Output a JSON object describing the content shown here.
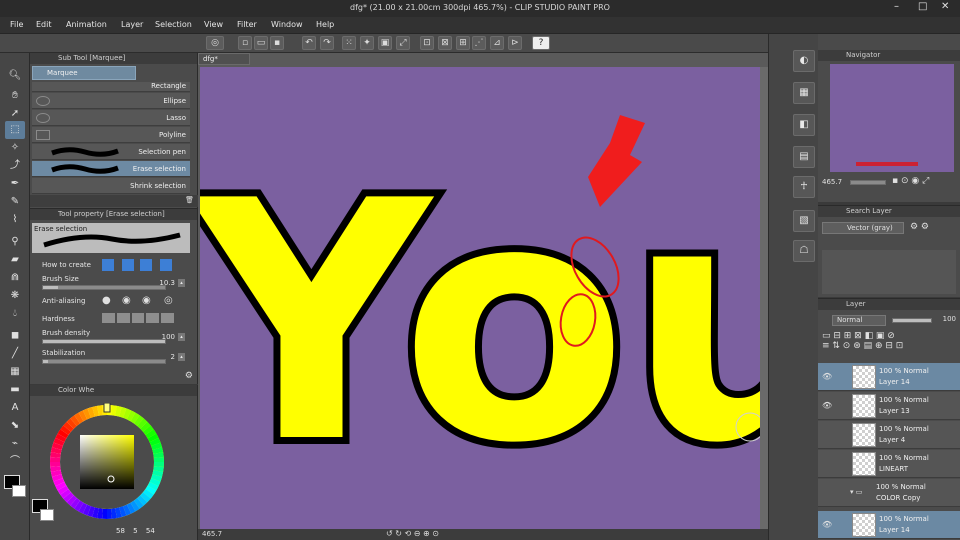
{
  "app": {
    "title": "dfg* (21.00 x 21.00cm 300dpi 465.7%) - CLIP STUDIO PAINT PRO",
    "window_controls": [
      "–",
      "□",
      "✕"
    ]
  },
  "menu": [
    "File",
    "Edit",
    "Animation",
    "Layer",
    "Selection",
    "View",
    "Filter",
    "Window",
    "Help"
  ],
  "subtool": {
    "title": "Sub Tool [Marquee]",
    "tab": "Marquee",
    "items": [
      {
        "label": "Rectangle"
      },
      {
        "label": "Ellipse"
      },
      {
        "label": "Lasso"
      },
      {
        "label": "Polyline"
      },
      {
        "label": "Selection pen"
      },
      {
        "label": "Erase selection"
      },
      {
        "label": "Shrink selection"
      }
    ]
  },
  "toolprop": {
    "title": "Tool property [Erase selection]",
    "preview_label": "Erase selection",
    "how_to_create": "How to create",
    "brush_size": {
      "label": "Brush Size",
      "value": "10.3",
      "fraction": 0.12
    },
    "anti_aliasing": "Anti-aliasing",
    "hardness": "Hardness",
    "brush_density": {
      "label": "Brush density",
      "value": "100",
      "fraction": 1.0
    },
    "stabilization": {
      "label": "Stabilization",
      "value": "2",
      "fraction": 0.04
    }
  },
  "colorwheel": {
    "title": "Color Whe",
    "readout": {
      "h": "58",
      "s": "5",
      "v": "54"
    }
  },
  "canvas": {
    "tab": "dfg*",
    "text": "You",
    "background": "#7b60a0",
    "fill": "#ffff00",
    "outline": "#000000",
    "annotation_color": "#ff1a1a"
  },
  "status": {
    "zoom": "465.7"
  },
  "navigator": {
    "title": "Navigator",
    "zoom": "465.7"
  },
  "searchlayer": {
    "title": "Search Layer",
    "layer_type": "Vector (gray)"
  },
  "layers": {
    "title": "Layer",
    "blend_mode": "Normal",
    "opacity": "100",
    "rows": [
      {
        "mode": "100 % Normal",
        "name": "Layer 14",
        "selected": true
      },
      {
        "mode": "100 % Normal",
        "name": "Layer 13",
        "selected": false
      },
      {
        "mode": "100 % Normal",
        "name": "Layer 4",
        "selected": false
      },
      {
        "mode": "100 % Normal",
        "name": "LINEART",
        "selected": false
      },
      {
        "mode": "100 % Normal",
        "name": "COLOR Copy",
        "selected": false
      },
      {
        "mode": "100 % Normal",
        "name": "Layer 14",
        "selected": true
      }
    ]
  },
  "colors": {
    "accent": "#6d8aa3",
    "panel": "#4b4b4b"
  }
}
